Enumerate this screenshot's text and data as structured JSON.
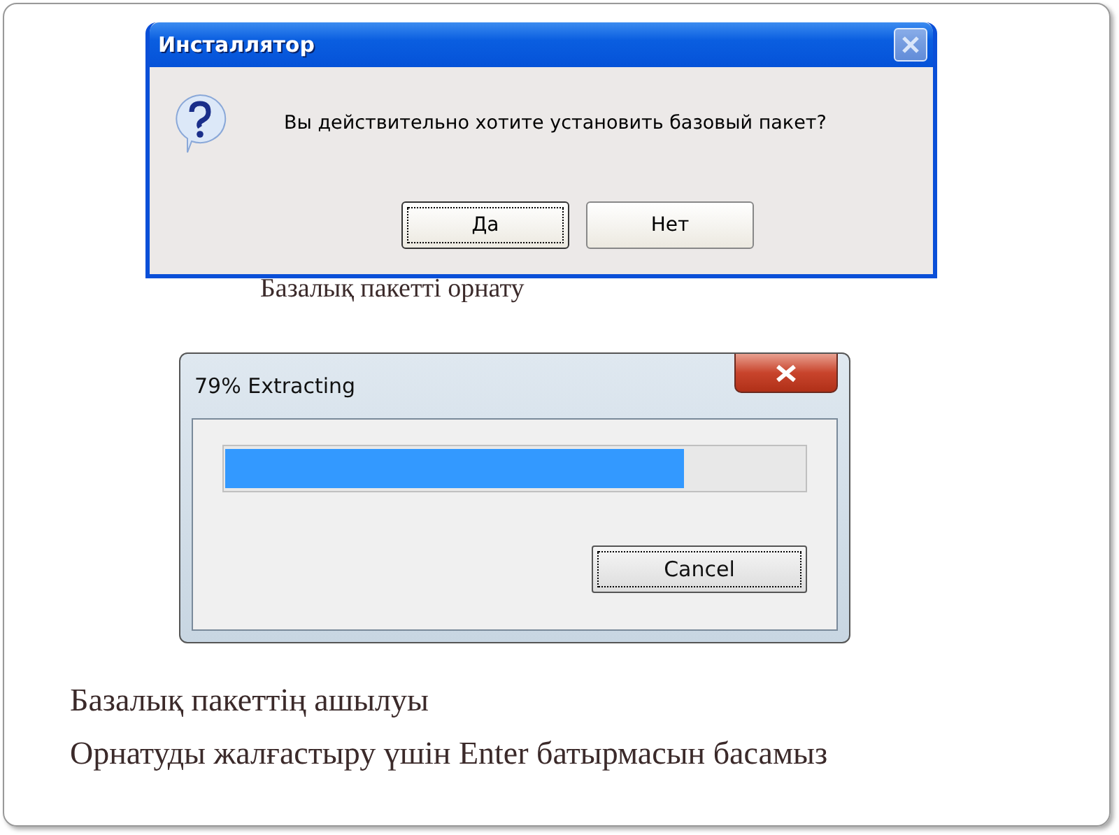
{
  "confirm_dialog": {
    "title": "Инсталлятор",
    "message": "Вы действительно хотите установить базовый пакет?",
    "buttons": [
      {
        "label": "Да",
        "focused": true
      },
      {
        "label": "Нет",
        "focused": false
      }
    ]
  },
  "confirm_caption": "Базалық пакетті орнату",
  "progress_dialog": {
    "title": "79% Extracting",
    "level": 0.79,
    "buttons": [
      {
        "label": "Cancel",
        "focused": true
      }
    ]
  },
  "notes": [
    "Базалық пакеттің ашылуы",
    "Орнатуды жалғастыру үшін Enter батырмасын басамыз"
  ]
}
